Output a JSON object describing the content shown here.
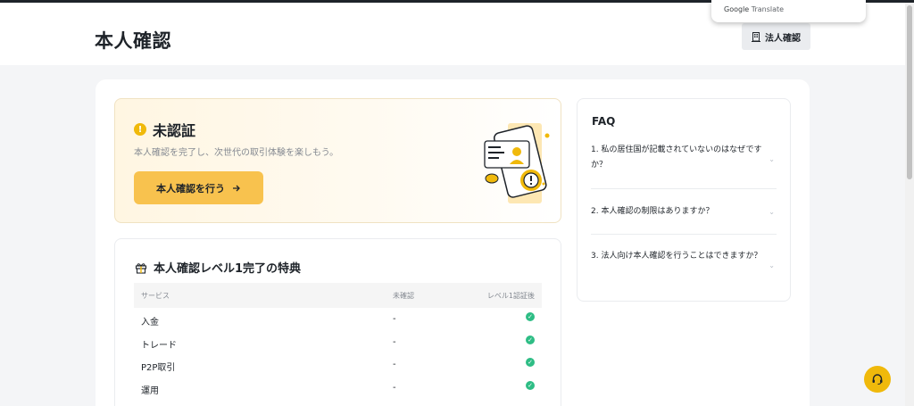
{
  "header": {
    "title": "本人確認",
    "corporate_button": "法人確認"
  },
  "google_translate": {
    "brand_google": "Google",
    "brand_translate": "Translate"
  },
  "status_card": {
    "title": "未認証",
    "subtitle": "本人確認を完了し、次世代の取引体験を楽しもう。",
    "cta_label": "本人確認を行う",
    "icon": "warning-icon"
  },
  "benefits": {
    "title": "本人確認レベル1完了の特典",
    "icon": "gift-icon",
    "columns": [
      "サービス",
      "未確認",
      "レベル1認証後"
    ],
    "rows": [
      {
        "service": "入金",
        "unverified": "-",
        "level1": "check"
      },
      {
        "service": "トレード",
        "unverified": "-",
        "level1": "check"
      },
      {
        "service": "P2P取引",
        "unverified": "-",
        "level1": "check"
      },
      {
        "service": "運用",
        "unverified": "-",
        "level1": "check"
      }
    ]
  },
  "faq": {
    "title": "FAQ",
    "items": [
      "1. 私の居住国が記載されていないのはなぜですか？",
      "2. 本人確認の制限はありますか？",
      "3. 法人向け本人確認を行うことはできますか？"
    ]
  },
  "colors": {
    "accent": "#f8c24e",
    "brand_yellow": "#f0b90b",
    "success": "#2ebd85",
    "text_primary": "#1e2329",
    "text_secondary": "#858a92"
  }
}
